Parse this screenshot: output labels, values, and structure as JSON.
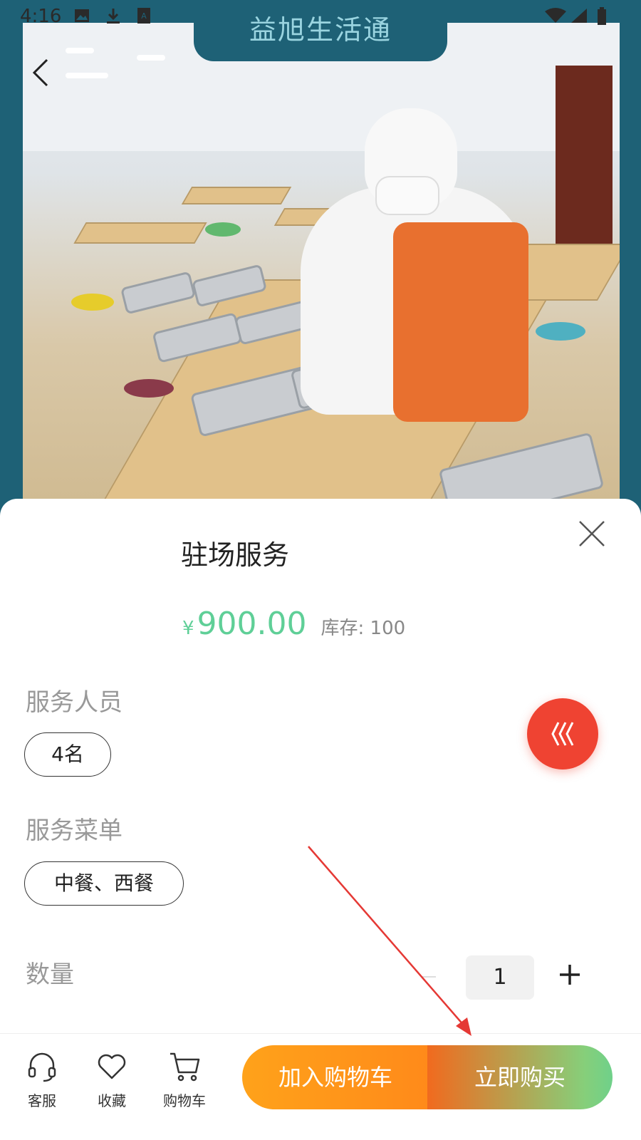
{
  "status_bar": {
    "time": "4:16"
  },
  "header": {
    "title": "益旭生活通"
  },
  "product": {
    "name": "驻场服务",
    "currency_symbol": "¥",
    "price": "900.00",
    "stock_label": "库存: 100"
  },
  "sections": {
    "staff": {
      "label": "服务人员",
      "option": "4名"
    },
    "menu": {
      "label": "服务菜单",
      "option": "中餐、西餐"
    },
    "quantity": {
      "label": "数量",
      "value": "1"
    }
  },
  "bottom_nav": {
    "service": "客服",
    "favorite": "收藏",
    "cart": "购物车"
  },
  "actions": {
    "add_to_cart": "加入购物车",
    "buy_now": "立即购买"
  },
  "colors": {
    "header_bg": "#1e6176",
    "price": "#5fcf97",
    "float_button": "#ef4332",
    "cart_button": "#ffa21a",
    "buy_button_start": "#f16a1e",
    "buy_button_end": "#6fd08a",
    "annotation_arrow": "#e53935"
  }
}
